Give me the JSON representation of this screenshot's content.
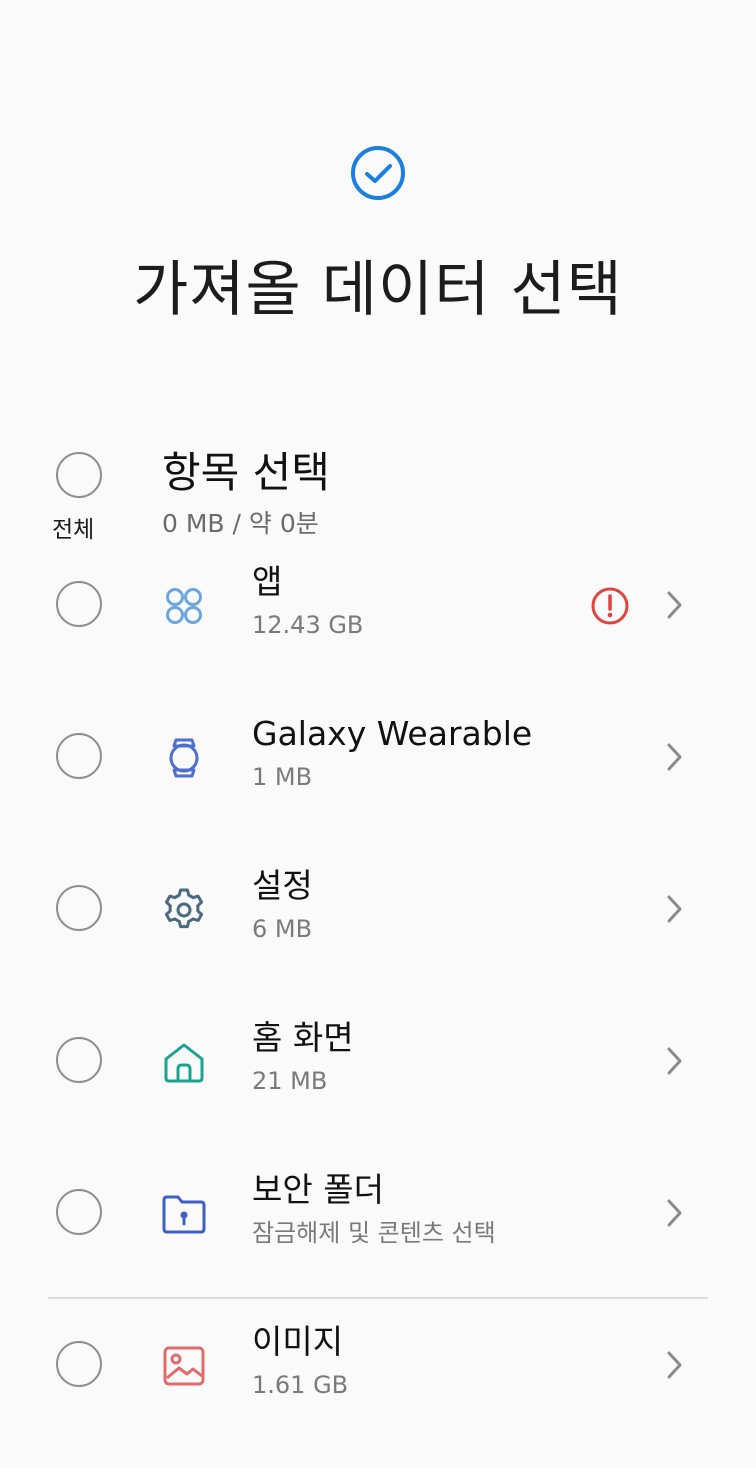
{
  "header": {
    "title": "가져올 데이터 선택"
  },
  "select_all": {
    "label": "전체",
    "section_title": "항목 선택",
    "summary": "0 MB / 약 0분"
  },
  "items": [
    {
      "title": "앱",
      "subtitle": "12.43 GB",
      "icon": "apps-grid-icon",
      "icon_color": "#6aa6e0"
    },
    {
      "title": "Galaxy Wearable",
      "subtitle": "1 MB",
      "icon": "watch-icon",
      "icon_color": "#4f6fd0"
    },
    {
      "title": "설정",
      "subtitle": "6 MB",
      "icon": "gear-icon",
      "icon_color": "#4b6a80"
    },
    {
      "title": "홈 화면",
      "subtitle": "21 MB",
      "icon": "home-icon",
      "icon_color": "#1ba38f"
    },
    {
      "title": "보안 폴더",
      "subtitle": "잠금해제 및 콘텐츠 선택",
      "icon": "secure-folder-icon",
      "icon_color": "#3f5fc8"
    },
    {
      "title": "이미지",
      "subtitle": "1.61 GB",
      "icon": "image-icon",
      "icon_color": "#e06b6b"
    }
  ],
  "colors": {
    "accent": "#1a7fe0",
    "warning": "#e0453d",
    "radio_border": "#8e8e8e",
    "chevron": "#8a8a8a"
  }
}
